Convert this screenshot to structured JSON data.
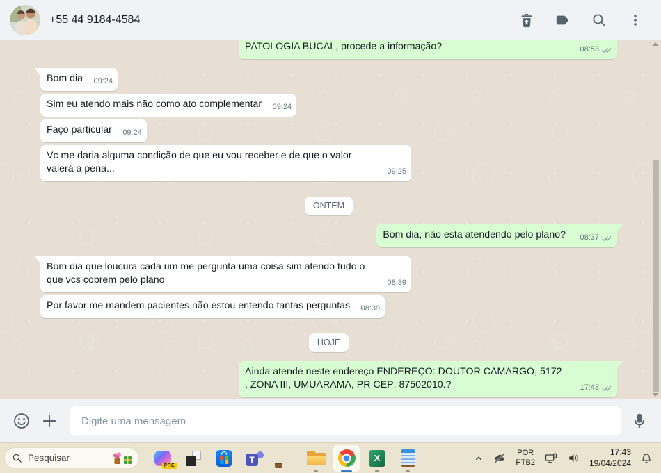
{
  "header": {
    "contact_name": "+55 44 9184-4584"
  },
  "chat": {
    "messages": [
      {
        "type": "out",
        "text": "PATOLOGIA BUCAL, procede a informação?",
        "time": "08:53",
        "status": "delivered"
      },
      {
        "type": "in",
        "text": "Bom dia",
        "time": "09:24"
      },
      {
        "type": "in",
        "text": "Sim eu atendo mais não como ato complementar",
        "time": "09:24"
      },
      {
        "type": "in",
        "text": "Faço particular",
        "time": "09:24"
      },
      {
        "type": "in",
        "text": "Vc me daria alguma condição de que eu vou receber e de que o valor valerá a pena...",
        "time": "09:25"
      },
      {
        "type": "divider",
        "text": "ONTEM"
      },
      {
        "type": "out",
        "text": "Bom dia, não esta atendendo pelo plano?",
        "time": "08:37",
        "status": "delivered"
      },
      {
        "type": "in",
        "text": "Bom dia que loucura cada um me pergunta uma coisa sim atendo tudo o que vcs cobrem pelo plano",
        "time": "08:39"
      },
      {
        "type": "in",
        "text": "Por favor me mandem pacientes não estou entendo tantas perguntas",
        "time": "08:39"
      },
      {
        "type": "divider",
        "text": "HOJE"
      },
      {
        "type": "out",
        "text": "Ainda atende neste endereço ENDEREÇO: DOUTOR CAMARGO, 5172 , ZONA III, UMUARAMA, PR CEP: 87502010.?",
        "time": "17:43",
        "status": "delivered"
      }
    ]
  },
  "composer": {
    "placeholder": "Digite uma mensagem"
  },
  "taskbar": {
    "search_label": "Pesquisar",
    "copilot_badge": "PRE",
    "language": {
      "line1": "POR",
      "line2": "PTB2"
    },
    "clock": {
      "time": "17:43",
      "date": "19/04/2024"
    }
  },
  "colors": {
    "outgoing_bubble": "#d9fdd3",
    "incoming_bubble": "#ffffff",
    "chat_background": "#e7dfd4",
    "panel_background": "#f0f2f5",
    "taskbar_background": "#eae4d0",
    "icon_gray": "#54656f"
  }
}
